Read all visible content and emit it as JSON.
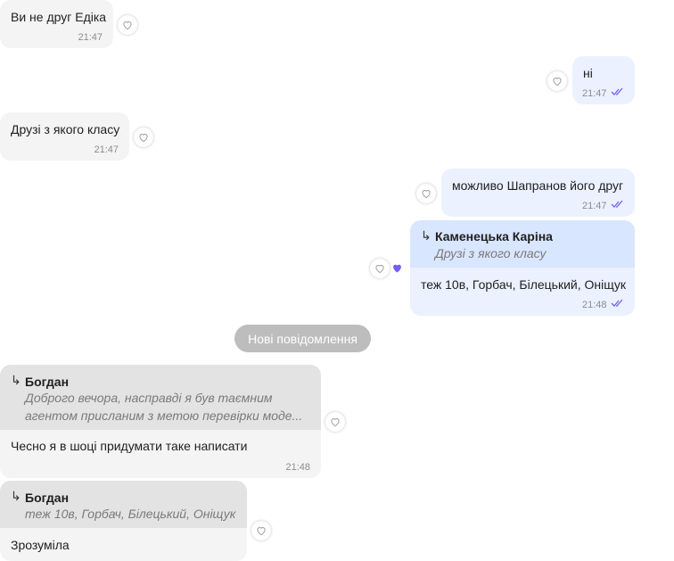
{
  "messages": [
    {
      "text": "Ви не друг Едіка",
      "time": "21:47"
    },
    {
      "text": "ні",
      "time": "21:47"
    },
    {
      "text": "Друзі з якого класу",
      "time": "21:47"
    },
    {
      "text": "можливо Шапранов його друг",
      "time": "21:47"
    },
    {
      "reply_name": "Каменецька Каріна",
      "reply_quote": "Друзі з якого класу",
      "text": "теж 10в, Горбач, Білецький, Оніщук",
      "time": "21:48"
    },
    {
      "reply_name": "Богдан",
      "reply_quote_1": "Доброго вечора, насправді я був таємним",
      "reply_quote_2": "агентом присланим з метою перевірки моде...",
      "text": "Чесно я в шоці придумати таке написати",
      "time": "21:48"
    },
    {
      "reply_name": "Богдан",
      "reply_quote": "теж 10в, Горбач, Білецький, Оніщук",
      "text": "Зрозуміла"
    }
  ],
  "divider": {
    "label": "Нові повідомлення"
  },
  "reply_arrow": "↳",
  "colors": {
    "incoming": "#f4f4f4",
    "outgoing": "#ebf1ff",
    "accent": "#7360f2",
    "divider": "#bdbdbd"
  },
  "icons": {
    "like": "heart-outline-icon",
    "liked": "heart-filled-icon",
    "read": "double-check-icon"
  }
}
